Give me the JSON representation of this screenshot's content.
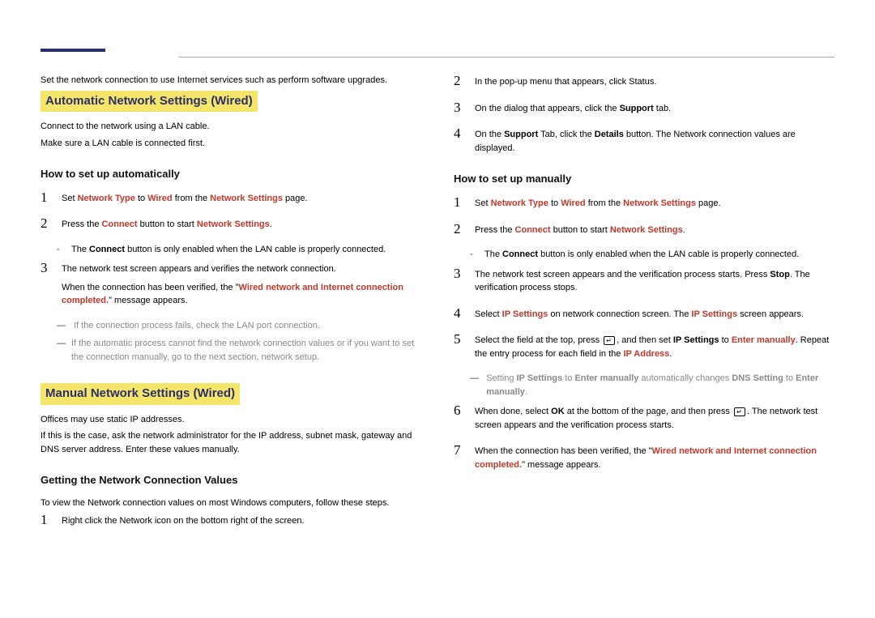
{
  "intro": "Set the network connection to use Internet services such as perform software upgrades.",
  "auto": {
    "heading": "Automatic Network Settings (Wired)",
    "p1": "Connect to the network using a LAN cable.",
    "p2": "Make sure a LAN cable is connected first.",
    "sub": "How to set up automatically",
    "s1a": "Set ",
    "s1b": "Network Type",
    "s1c": " to ",
    "s1d": "Wired",
    "s1e": " from the ",
    "s1f": "Network Settings",
    "s1g": " page.",
    "s2a": "Press the ",
    "s2b": "Connect",
    "s2c": " button to start ",
    "s2d": "Network Settings",
    "s2e": ".",
    "s2_dash_a": "The ",
    "s2_dash_b": "Connect",
    "s2_dash_c": " button is only enabled when the LAN cable is properly connected.",
    "s3a": "The network test screen appears and verifies the network connection.",
    "s3b_a": "When the connection has been verified, the \"",
    "s3b_b": "Wired network and Internet connection completed.",
    "s3b_c": "\" message appears.",
    "g1": "If the connection process fails, check the LAN port connection.",
    "g2": "If the automatic process cannot find the network connection values or if you want to set the connection manually, go to the next section, network setup."
  },
  "manual": {
    "heading": "Manual Network Settings (Wired)",
    "p1": "Offices may use static IP addresses.",
    "p2": "If this is the case, ask the network administrator for the IP address, subnet mask, gateway and DNS server address. Enter these values manually.",
    "sub1": "Getting the Network Connection Values",
    "sub1_p": "To view the Network connection values on most Windows computers, follow these steps.",
    "g1": "Right click the Network icon on the bottom right of the screen."
  },
  "right": {
    "r2": "In the pop-up menu that appears, click Status.",
    "r3a": "On the dialog that appears, click the ",
    "r3b": "Support",
    "r3c": " tab.",
    "r4a": "On the ",
    "r4b": "Support",
    "r4c": " Tab, click the ",
    "r4d": "Details",
    "r4e": " button. The Network connection values are displayed.",
    "sub": "How to set up manually",
    "m1a": "Set ",
    "m1b": "Network Type",
    "m1c": " to ",
    "m1d": "Wired",
    "m1e": " from the ",
    "m1f": "Network Settings",
    "m1g": " page.",
    "m2a": "Press the ",
    "m2b": "Connect",
    "m2c": " button to start ",
    "m2d": "Network Settings",
    "m2e": ".",
    "m2_dash_a": "The ",
    "m2_dash_b": "Connect",
    "m2_dash_c": " button is only enabled when the LAN cable is properly connected.",
    "m3a": "The network test screen appears and the verification process starts. Press ",
    "m3b": "Stop",
    "m3c": ". The verification process stops.",
    "m4a": "Select ",
    "m4b": "IP Settings",
    "m4c": " on network connection screen. The ",
    "m4d": "IP Settings",
    "m4e": " screen appears.",
    "m5a": "Select the field at the top, press ",
    "m5b": ", and then set ",
    "m5c": "IP Settings",
    "m5d": " to ",
    "m5e": "Enter manually",
    "m5f": ". Repeat the entry process for each field in the ",
    "m5g": "IP Address",
    "m5h": ".",
    "m5_dash_a": "Setting ",
    "m5_dash_b": "IP Settings",
    "m5_dash_c": " to ",
    "m5_dash_d": "Enter manually",
    "m5_dash_e": " automatically changes ",
    "m5_dash_f": "DNS Setting",
    "m5_dash_g": " to ",
    "m5_dash_h": "Enter manually",
    "m5_dash_i": ".",
    "m6a": "When done, select ",
    "m6b": "OK",
    "m6c": " at the bottom of the page, and then press ",
    "m6d": ". The network test screen appears and the verification process starts.",
    "m7a": "When the connection has been verified, the \"",
    "m7b": "Wired network and Internet connection completed.",
    "m7c": "\" message appears."
  }
}
